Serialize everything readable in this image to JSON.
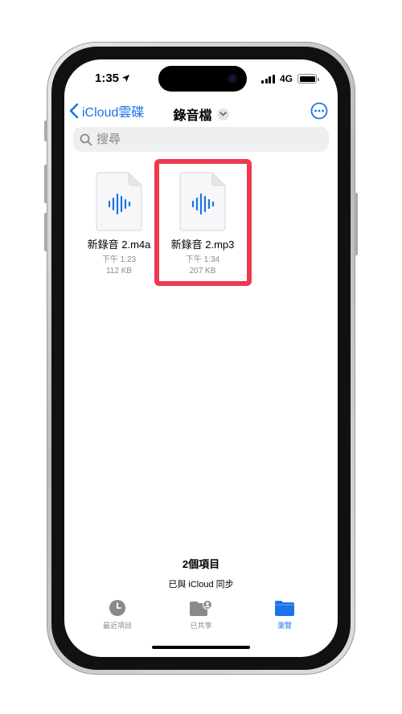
{
  "status": {
    "time": "1:35",
    "network": "4G"
  },
  "nav": {
    "back_label": "iCloud雲碟",
    "title": "錄音檔"
  },
  "search": {
    "placeholder": "搜尋"
  },
  "files": [
    {
      "name": "新錄音 2.m4a",
      "time": "下午 1:23",
      "size": "112 KB"
    },
    {
      "name": "新錄音 2.mp3",
      "time": "下午 1:34",
      "size": "207 KB"
    }
  ],
  "footer": {
    "item_count": "2個項目",
    "sync_status": "已與 iCloud 同步"
  },
  "tabs": [
    {
      "label": "最近項目",
      "icon": "clock-icon",
      "active": false
    },
    {
      "label": "已共享",
      "icon": "shared-folder-icon",
      "active": false
    },
    {
      "label": "瀏覽",
      "icon": "folder-icon",
      "active": true
    }
  ],
  "colors": {
    "accent": "#1a73e8",
    "highlight": "#ee3a50",
    "waveform": "#1a73e8"
  }
}
